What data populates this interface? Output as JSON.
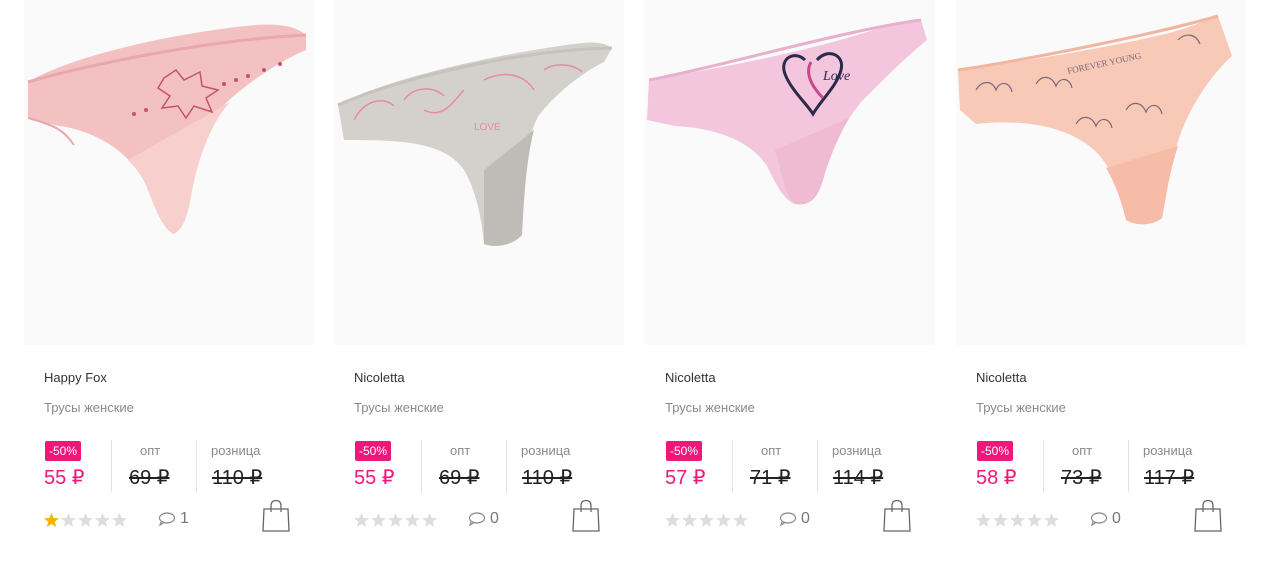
{
  "labels": {
    "opt": "опт",
    "retail": "розница"
  },
  "colors": {
    "accent": "#f0167a",
    "star_filled": "#f5b400",
    "star_empty": "#dddddd"
  },
  "products": [
    {
      "brand": "Happy Fox",
      "name": "Трусы женские",
      "discount": "-50%",
      "price": "55 ₽",
      "opt_price": "69 ₽",
      "retail_price": "110 ₽",
      "rating": 1,
      "comments": "1",
      "image": "pink briefs with printed girl logo"
    },
    {
      "brand": "Nicoletta",
      "name": "Трусы женские",
      "discount": "-50%",
      "price": "55 ₽",
      "opt_price": "69 ₽",
      "retail_price": "110 ₽",
      "rating": 0,
      "comments": "0",
      "image": "grey briefs with pink LOVE print"
    },
    {
      "brand": "Nicoletta",
      "name": "Трусы женские",
      "discount": "-50%",
      "price": "57 ₽",
      "opt_price": "71 ₽",
      "retail_price": "114 ₽",
      "rating": 0,
      "comments": "0",
      "image": "light pink briefs with heart Love print"
    },
    {
      "brand": "Nicoletta",
      "name": "Трусы женские",
      "discount": "-50%",
      "price": "58 ₽",
      "opt_price": "73 ₽",
      "retail_price": "117 ₽",
      "rating": 0,
      "comments": "0",
      "image": "peach briefs with lily Forever Young print"
    }
  ]
}
